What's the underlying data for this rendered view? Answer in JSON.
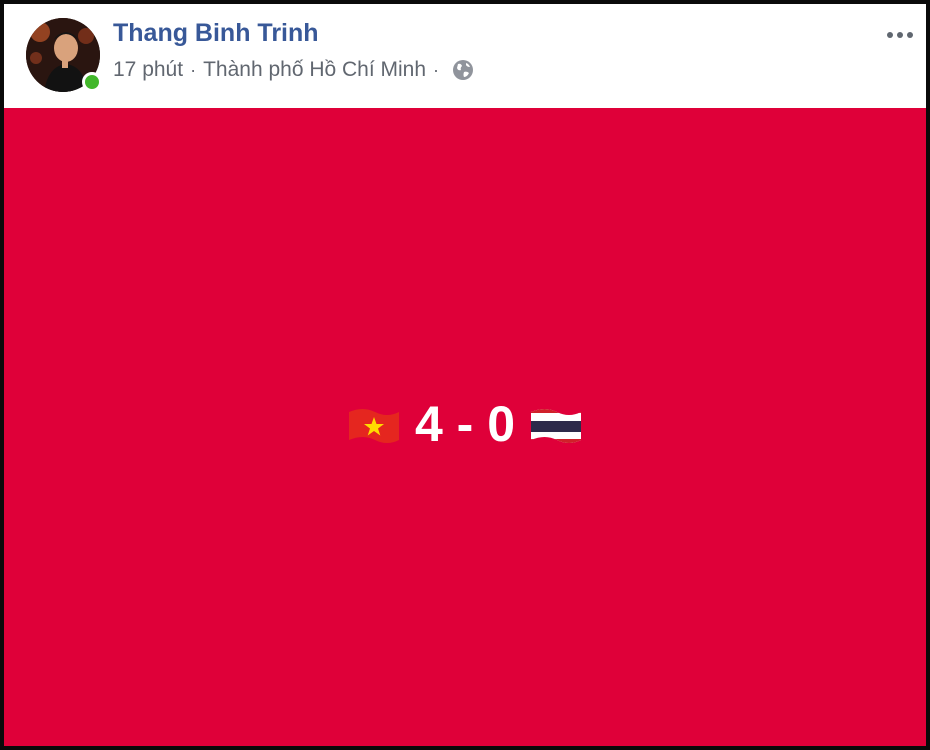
{
  "post": {
    "author": "Thang Binh Trinh",
    "time": "17 phút",
    "separator": "·",
    "location": "Thành phố Hồ Chí Minh",
    "privacy_icon": "globe-icon",
    "online": true,
    "online_color": "#42b72a"
  },
  "status": {
    "background_color": "#df0039",
    "left_flag": "vietnam-flag-icon",
    "score": "4 - 0",
    "right_flag": "thailand-flag-icon"
  },
  "colors": {
    "author_link": "#385898",
    "meta_text": "#616770"
  }
}
